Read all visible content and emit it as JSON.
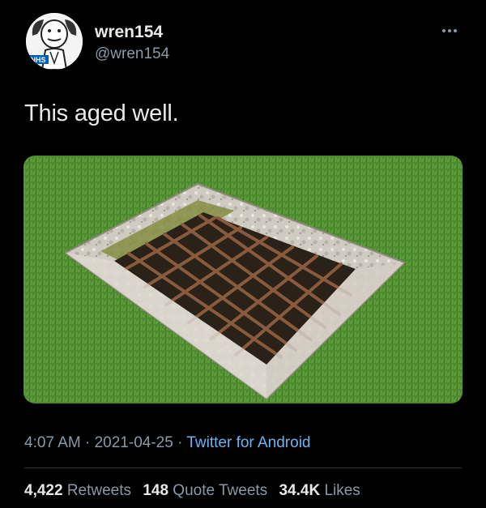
{
  "user": {
    "display_name": "wren154",
    "handle": "@wren154",
    "avatar_badge": "NHS",
    "avatar_icon": "cartoon-face-with-nhs-badge"
  },
  "tweet": {
    "text": "This aged well.",
    "media_icon": "drain-grate-photo"
  },
  "meta": {
    "time": "4:07 AM",
    "separator1": " · ",
    "date": "2021-04-25",
    "separator2": " · ",
    "source": "Twitter for Android"
  },
  "stats": {
    "retweets_count": "4,422",
    "retweets_label": "Retweets",
    "quotes_count": "148",
    "quotes_label": "Quote Tweets",
    "likes_count": "34.4K",
    "likes_label": "Likes"
  },
  "colors": {
    "background": "#000000",
    "text": "#e7e9ea",
    "secondary": "#8b98a5",
    "link": "#6cb4f0"
  }
}
